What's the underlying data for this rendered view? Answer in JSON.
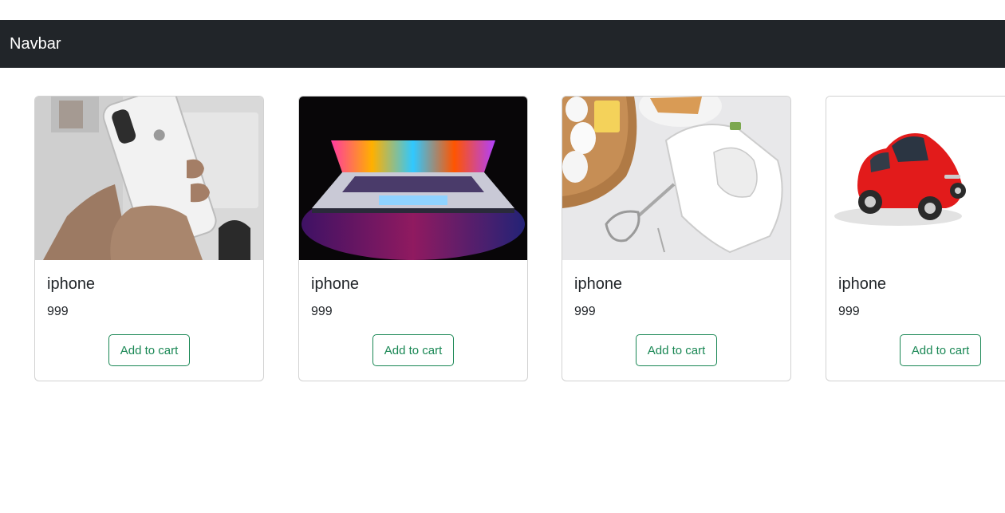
{
  "navbar": {
    "brand": "Navbar"
  },
  "products": [
    {
      "title": "iphone",
      "price": "999",
      "button_label": "Add to cart",
      "image": "hand-holding-iphone-image"
    },
    {
      "title": "iphone",
      "price": "999",
      "button_label": "Add to cart",
      "image": "colorful-laptop-image"
    },
    {
      "title": "iphone",
      "price": "999",
      "button_label": "Add to cart",
      "image": "hand-mixer-kitchen-image"
    },
    {
      "title": "iphone",
      "price": "999",
      "button_label": "Add to cart",
      "image": "red-toy-car-image"
    }
  ],
  "colors": {
    "navbar_bg": "#212529",
    "button_outline": "#198754",
    "card_border": "#dcdcdc"
  }
}
